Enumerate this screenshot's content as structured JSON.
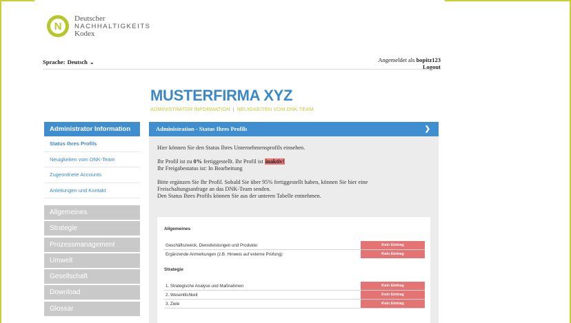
{
  "brand": {
    "logo_letter": "N",
    "line1": "Deutscher",
    "line2": "NACHHALTIGKEITS",
    "line3": "Kodex"
  },
  "topbar": {
    "language_label": "Sprache:",
    "language_value": "Deutsch",
    "logged_in_prefix": "Angemeldet als",
    "username": "bopitz123",
    "logout": "Logout"
  },
  "header": {
    "company": "MUSTERFIRMA XYZ",
    "link_admin": "ADMINISTRATOR INFORMATION",
    "separator": "|",
    "link_news": "NEUIGKEITEN VOM DNK-TEAM"
  },
  "sidebar": {
    "title": "Administrator Information",
    "links": [
      {
        "label": "Status Ihres Profils",
        "active": true
      },
      {
        "label": "Neuigkeiten vom DNK-Team",
        "active": false
      },
      {
        "label": "Zugeordnete Accounts",
        "active": false
      },
      {
        "label": "Anleitungen und Kontakt",
        "active": false
      }
    ],
    "categories": [
      "Allgemeines",
      "Strategie",
      "Prozessmanagement",
      "Umwelt",
      "Gesellschaft",
      "Download",
      "Glossar"
    ]
  },
  "panel": {
    "title": "Administration - Status Ihres Profils",
    "intro": "Hier können Sie den Status Ihres Unternehmensprofils einsehen.",
    "progress_prefix": "Ihr Profil ist zu ",
    "progress_value": "0%",
    "progress_mid": " fertiggestellt. Ihr Profil ist ",
    "profile_state": "inaktiv!",
    "release_line": "Ihr Freigabestatus ist:  In Bearbeitung",
    "info_line1": "Bitte ergänzen Sie Ihr Profil. Sobald Sie über 95% fertiggestellt haben, können Sie hier eine",
    "info_line2": "Freischaltungsanfrage an das DNK-Team senden.",
    "info_line3": "Den Status Ihres Profils können Sie aus der unteren Tabelle entnehmen."
  },
  "status_table": {
    "sections": [
      {
        "title": "Allgemeines",
        "rows": [
          {
            "label": "Geschäftszweck, Dienstleistungen und Produkte:",
            "status": "Kein Eintrag"
          },
          {
            "label": "Ergänzende Anmerkungen (z.B. Hinweis auf externe Prüfung):",
            "status": "Kein Eintrag"
          }
        ]
      },
      {
        "title": "Strategie",
        "rows": [
          {
            "label": "1. Strategische Analyse und Maßnahmen",
            "status": "Kein Eintrag"
          },
          {
            "label": "2. Wesentlichkeit",
            "status": "Kein Eintrag"
          },
          {
            "label": "3. Ziele",
            "status": "Kein Eintrag"
          }
        ]
      }
    ]
  },
  "colors": {
    "accent_blue": "#3e8ed0",
    "lime": "#b7c72a",
    "status_red": "#e47474",
    "category_grey": "#c9c9c9"
  }
}
